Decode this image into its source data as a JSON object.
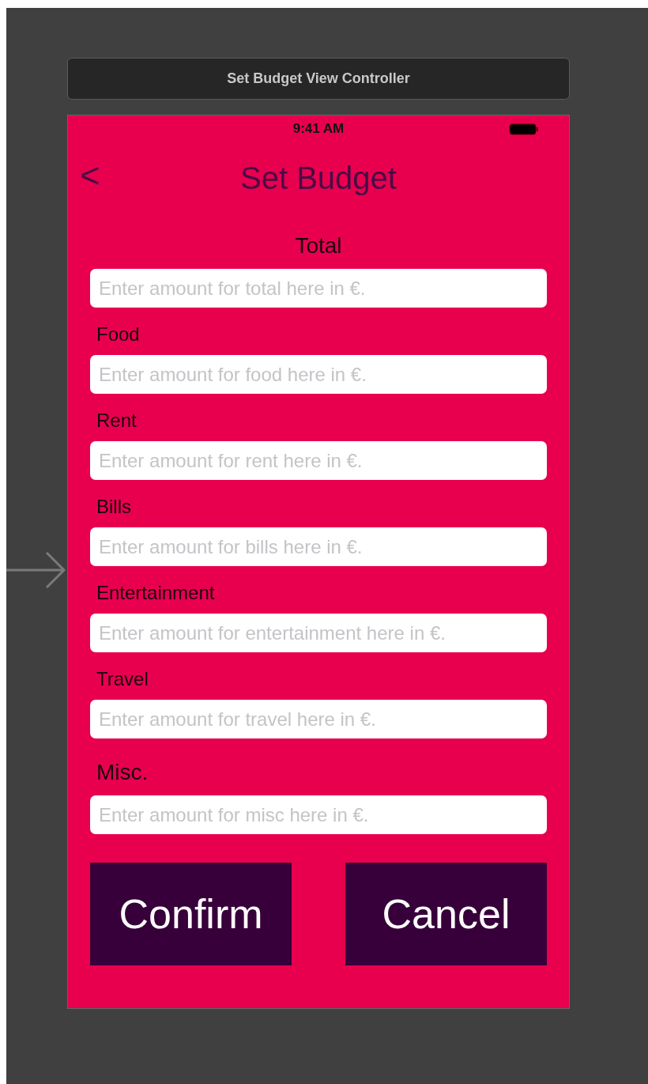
{
  "scene_title": "Set Budget View Controller",
  "status_bar": {
    "time": "9:41 AM"
  },
  "nav": {
    "back": "<",
    "title": "Set Budget"
  },
  "fields": [
    {
      "kind": "heading",
      "label": "Total",
      "placeholder": "Enter amount for total here in €."
    },
    {
      "kind": "label",
      "label": "Food",
      "placeholder": "Enter amount for food here in €."
    },
    {
      "kind": "label",
      "label": "Rent",
      "placeholder": "Enter amount for rent here in €."
    },
    {
      "kind": "label",
      "label": "Bills",
      "placeholder": "Enter amount for bills here in €."
    },
    {
      "kind": "label",
      "label": "Entertainment",
      "placeholder": "Enter amount for entertainment here in €."
    },
    {
      "kind": "label",
      "label": "Travel",
      "placeholder": "Enter amount for travel here in €."
    },
    {
      "kind": "large",
      "label": "Misc.",
      "placeholder": "Enter amount for misc here in €."
    }
  ],
  "buttons": [
    "Confirm",
    "Cancel"
  ]
}
